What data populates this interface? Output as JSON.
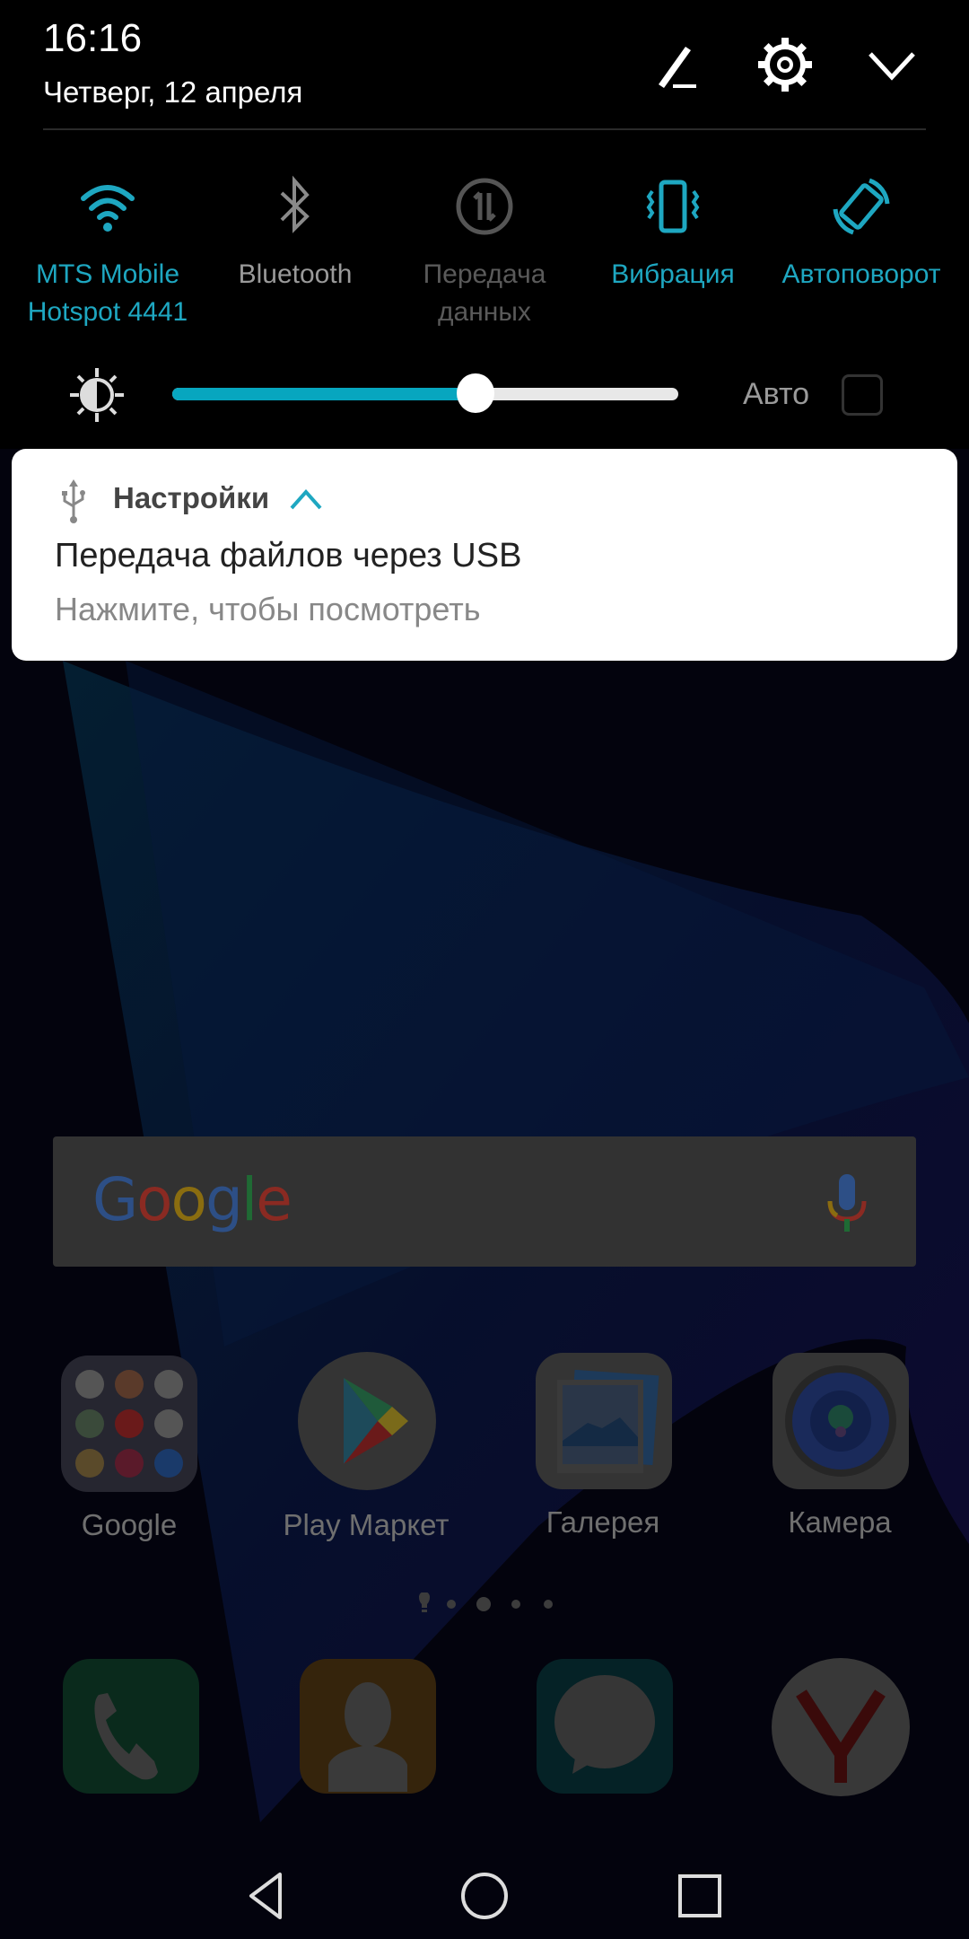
{
  "status": {
    "time": "16:16",
    "date": "Четверг, 12 апреля"
  },
  "header_icons": [
    "edit-icon",
    "settings-icon",
    "collapse-chevron-icon"
  ],
  "quick_settings": [
    {
      "id": "wifi",
      "label_line1": "MTS Mobile",
      "label_line2": "Hotspot 4441",
      "state": "on"
    },
    {
      "id": "bluetooth",
      "label_line1": "Bluetooth",
      "label_line2": "",
      "state": "off"
    },
    {
      "id": "mobile-data",
      "label_line1": "Передача",
      "label_line2": "данных",
      "state": "disabled"
    },
    {
      "id": "vibration",
      "label_line1": "Вибрация",
      "label_line2": "",
      "state": "on"
    },
    {
      "id": "auto-rotate",
      "label_line1": "Автоповорот",
      "label_line2": "",
      "state": "on"
    }
  ],
  "brightness": {
    "level_percent": 60,
    "auto_label": "Авто",
    "auto_checked": false
  },
  "notification": {
    "app_name": "Настройки",
    "title": "Передача файлов через USB",
    "text": "Нажмите, чтобы посмотреть",
    "expanded": true
  },
  "search_widget": {
    "logo": "Google"
  },
  "apps": [
    {
      "label": "Google",
      "icon": "google-folder-icon"
    },
    {
      "label": "Play Маркет",
      "icon": "play-store-icon"
    },
    {
      "label": "Галерея",
      "icon": "gallery-icon"
    },
    {
      "label": "Камера",
      "icon": "camera-icon"
    }
  ],
  "dock": [
    {
      "name": "phone",
      "icon": "phone-icon"
    },
    {
      "name": "contacts",
      "icon": "contacts-icon"
    },
    {
      "name": "messages",
      "icon": "messages-icon"
    },
    {
      "name": "yandex-browser",
      "icon": "yandex-icon"
    }
  ],
  "page_indicator": {
    "pages": 5,
    "current": 3
  },
  "colors": {
    "accent": "#1ea7c1",
    "panel": "#000000",
    "card": "#ffffff"
  }
}
